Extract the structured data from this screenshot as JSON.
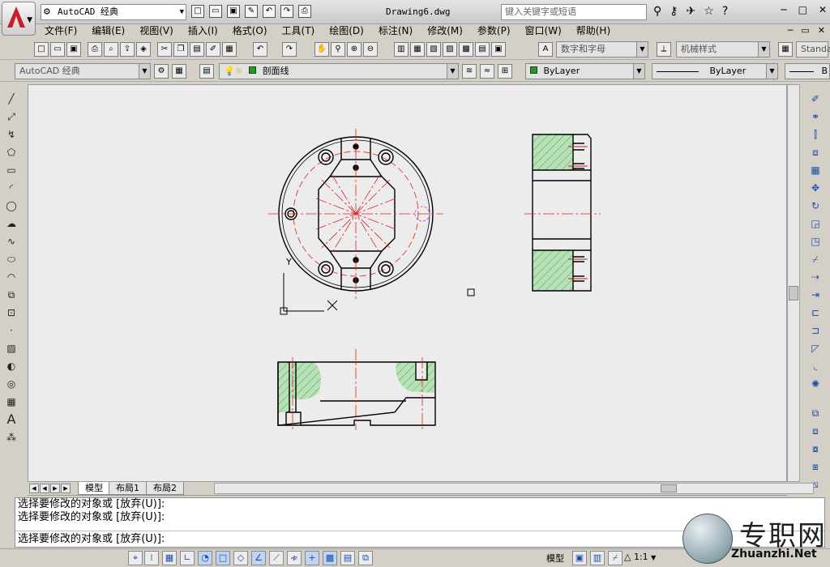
{
  "window": {
    "workspace": "AutoCAD 经典",
    "doc_title": "Drawing6.dwg",
    "search_placeholder": "键入关键字或短语"
  },
  "menu": [
    "文件(F)",
    "编辑(E)",
    "视图(V)",
    "插入(I)",
    "格式(O)",
    "工具(T)",
    "绘图(D)",
    "标注(N)",
    "修改(M)",
    "参数(P)",
    "窗口(W)",
    "帮助(H)"
  ],
  "toolbar": {
    "text_style": "数字和字母",
    "dim_style": "机械样式",
    "table_style": "Standa",
    "workspace2": "AutoCAD 经典",
    "layer": "剖面线",
    "color": "ByLayer",
    "linetype": "ByLayer",
    "lineweight": "B"
  },
  "tabs": [
    "模型",
    "布局1",
    "布局2"
  ],
  "command": {
    "line1": "选择要修改的对象或 [放弃(U)]:",
    "line2": "选择要修改的对象或 [放弃(U)]:",
    "prompt": "选择要修改的对象或 [放弃(U)]:"
  },
  "status": {
    "model": "模型",
    "scale": "1:1"
  },
  "ucs": {
    "x_label": "X",
    "y_label": "Y"
  },
  "watermark": {
    "cn": "专职网",
    "en": "Zhuanzhi.Net"
  },
  "colors": {
    "hatch": "#a8d8a8",
    "center_line": "#e02020",
    "outline": "#000000",
    "purple": "#c040c0"
  }
}
